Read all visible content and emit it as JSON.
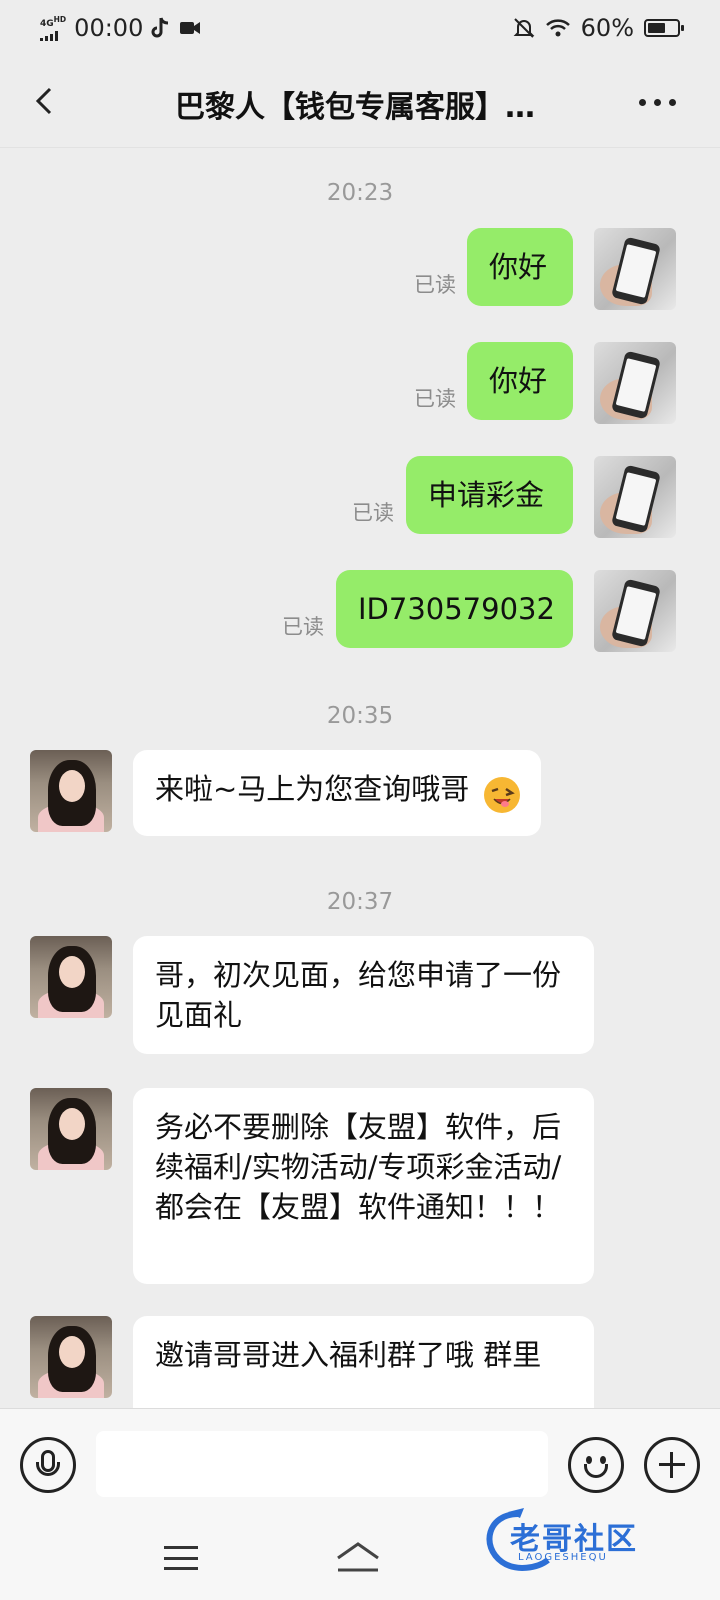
{
  "status_bar": {
    "network": "4G",
    "network_sup": "HD",
    "time": "00:00",
    "battery": "60%",
    "battery_level": 0.6,
    "icons": [
      "signal-icon",
      "tiktok-icon",
      "video-icon",
      "mute-icon",
      "wifi-icon",
      "battery-icon"
    ]
  },
  "header": {
    "title": "巴黎人【钱包专属客服】…"
  },
  "messages": [
    {
      "type": "time",
      "text": "20:23"
    },
    {
      "type": "out",
      "text": "你好",
      "read_label": "已读"
    },
    {
      "type": "out",
      "text": "你好",
      "read_label": "已读"
    },
    {
      "type": "out",
      "text": "申请彩金",
      "read_label": "已读"
    },
    {
      "type": "out",
      "text": "ID730579032",
      "read_label": "已读"
    },
    {
      "type": "time",
      "text": "20:35"
    },
    {
      "type": "in",
      "text": "来啦~马上为您查询哦哥"
    },
    {
      "type": "time",
      "text": "20:37"
    },
    {
      "type": "in",
      "text": "哥，初次见面，给您申请了一份见面礼"
    },
    {
      "type": "in",
      "text": "务必不要删除【友盟】软件，后续福利/实物活动/专项彩金活动/都会在【友盟】软件通知！！！"
    },
    {
      "type": "in",
      "text": "邀请哥哥进入福利群了哦 群里"
    }
  ],
  "input_bar": {
    "value": "",
    "placeholder": ""
  },
  "watermark": {
    "title": "老哥社区",
    "subtitle": "LAOGESHEQU"
  },
  "colors": {
    "outgoing_bubble": "#95ec69",
    "incoming_bubble": "#ffffff",
    "background": "#ededed",
    "read_label": "#8c8c8c"
  }
}
